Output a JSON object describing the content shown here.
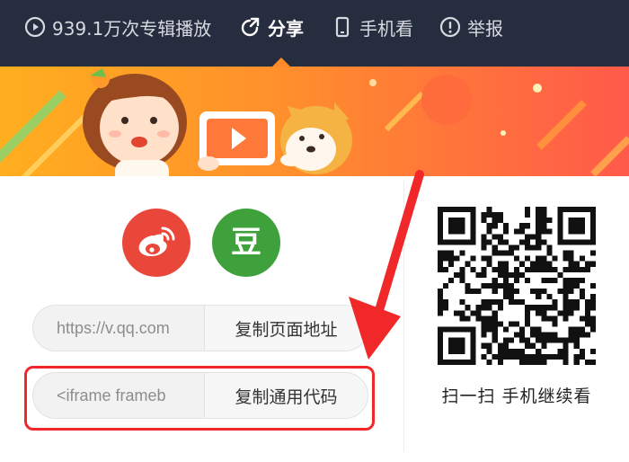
{
  "topbar": {
    "items": [
      {
        "label": "939.1万次专辑播放",
        "icon": "play-circle-icon"
      },
      {
        "label": "分享",
        "icon": "share-icon",
        "active": true
      },
      {
        "label": "手机看",
        "icon": "phone-icon"
      },
      {
        "label": "举报",
        "icon": "warning-icon"
      }
    ],
    "active_color": "#ff8a2a"
  },
  "share": {
    "weibo_icon": "weibo-icon",
    "douban_label": "豆",
    "page_url": {
      "value": "https://v.qq.com",
      "button_label": "复制页面地址"
    },
    "embed_code": {
      "value": "<iframe frameb",
      "button_label": "复制通用代码"
    }
  },
  "qr": {
    "caption": "扫一扫 手机继续看"
  },
  "colors": {
    "topbar_bg": "#262d3e",
    "weibo": "#e9473a",
    "douban": "#3ea13c",
    "highlight": "#f0282a"
  }
}
